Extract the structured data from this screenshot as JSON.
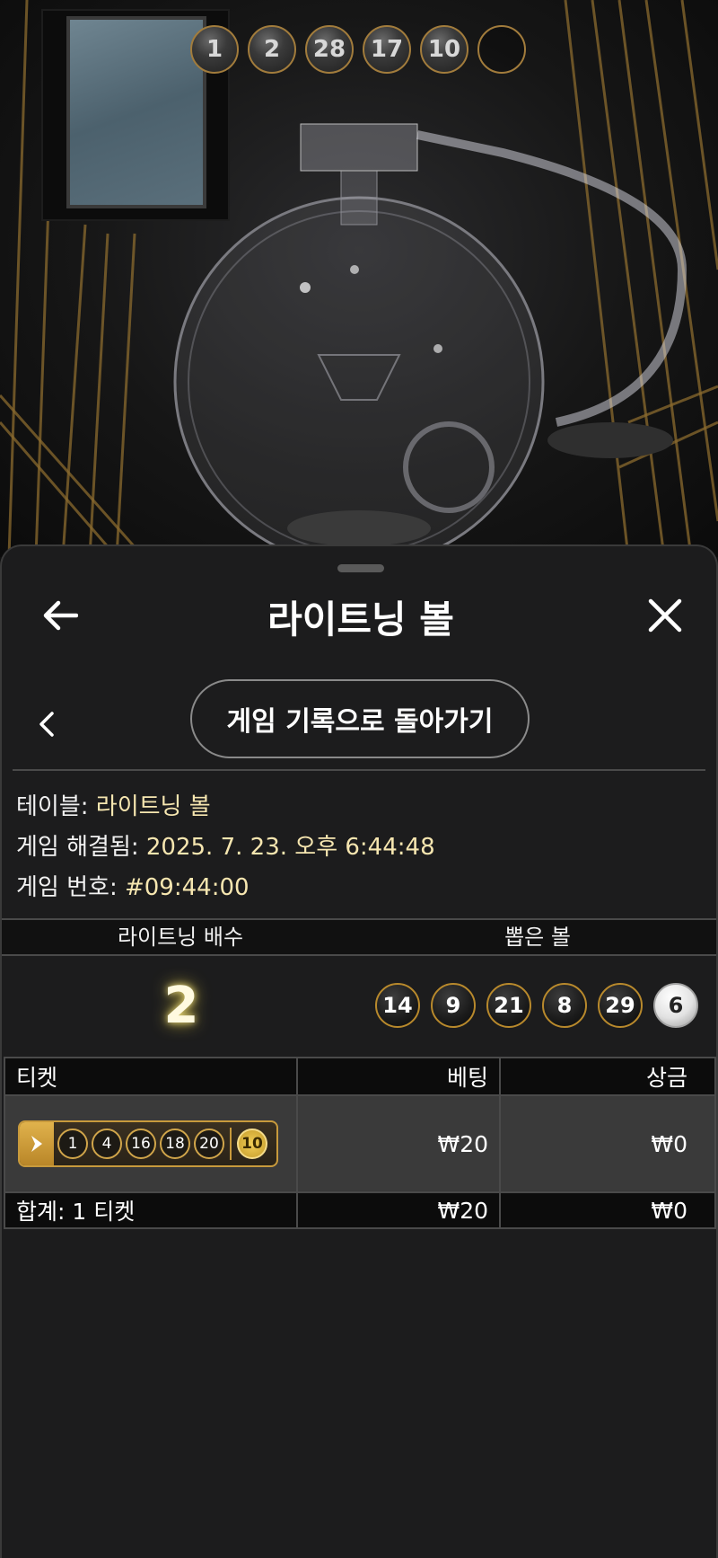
{
  "drawn_strip": {
    "balls": [
      "1",
      "2",
      "28",
      "17",
      "10",
      ""
    ]
  },
  "header": {
    "title": "라이트닝 볼"
  },
  "history_button": {
    "label": "게임 기록으로 돌아가기"
  },
  "info": {
    "table_label": "테이블:",
    "table_value": "라이트닝 볼",
    "resolved_label": "게임 해결됨:",
    "resolved_value": "2025. 7. 23. 오후 6:44:48",
    "game_no_label": "게임 번호:",
    "game_no_value": "#09:44:00"
  },
  "result": {
    "multiplier_header": "라이트닝 배수",
    "balls_header": "뽑은 볼",
    "multiplier": "2",
    "balls": [
      "14",
      "9",
      "21",
      "8",
      "29",
      "6"
    ]
  },
  "tickets": {
    "col_ticket": "티켓",
    "col_bet": "베팅",
    "col_prize": "상금",
    "rows": [
      {
        "numbers": [
          "1",
          "4",
          "16",
          "18",
          "20"
        ],
        "bonus": "10",
        "bet": "₩20",
        "prize": "₩0"
      }
    ],
    "total_label": "합계: 1 티켓",
    "total_bet": "₩20",
    "total_prize": "₩0"
  },
  "colors": {
    "gold": "#c89a3c",
    "highlight_text": "#f6e6b0",
    "sheet_bg": "#1c1c1d"
  },
  "icons": [
    "back-arrow-icon",
    "close-icon",
    "chevron-left-icon",
    "lightning-tag-icon"
  ]
}
